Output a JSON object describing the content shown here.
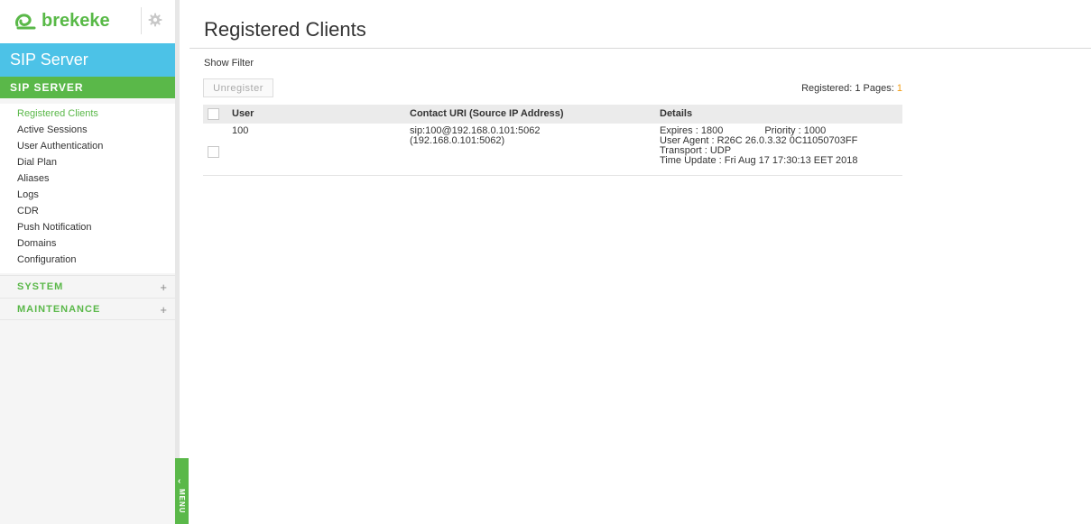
{
  "brand": {
    "logo_text": "brekeke",
    "app_title": "SIP Server",
    "accent": "#4cc2e7",
    "green": "#5ab849"
  },
  "sidebar": {
    "section_title": "SIP SERVER",
    "items": [
      {
        "label": "Registered Clients",
        "active": true
      },
      {
        "label": "Active Sessions"
      },
      {
        "label": "User Authentication"
      },
      {
        "label": "Dial Plan"
      },
      {
        "label": "Aliases"
      },
      {
        "label": "Logs"
      },
      {
        "label": "CDR"
      },
      {
        "label": "Push Notification"
      },
      {
        "label": "Domains"
      },
      {
        "label": "Configuration"
      }
    ],
    "groups": [
      {
        "label": "SYSTEM",
        "toggle": "+"
      },
      {
        "label": "MAINTENANCE",
        "toggle": "+"
      }
    ],
    "menu_tab": {
      "label": "MENU",
      "chevron": "‹"
    }
  },
  "main": {
    "title": "Registered Clients",
    "show_filter": "Show Filter",
    "unregister_label": "Unregister",
    "registered_label": "Registered: 1  Pages:",
    "page": "1",
    "columns": [
      "User",
      "Contact URI (Source IP Address)",
      "Details"
    ],
    "rows": [
      {
        "user": "100",
        "contact_uri": "sip:100@192.168.0.101:5062",
        "source_ip": "(192.168.0.101:5062)",
        "expires": "Expires : 1800",
        "priority": "Priority : 1000",
        "user_agent": "User Agent : R26C 26.0.3.32 0C11050703FF",
        "transport": "Transport : UDP",
        "time_update": "Time Update : Fri Aug 17 17:30:13 EET 2018"
      }
    ]
  }
}
